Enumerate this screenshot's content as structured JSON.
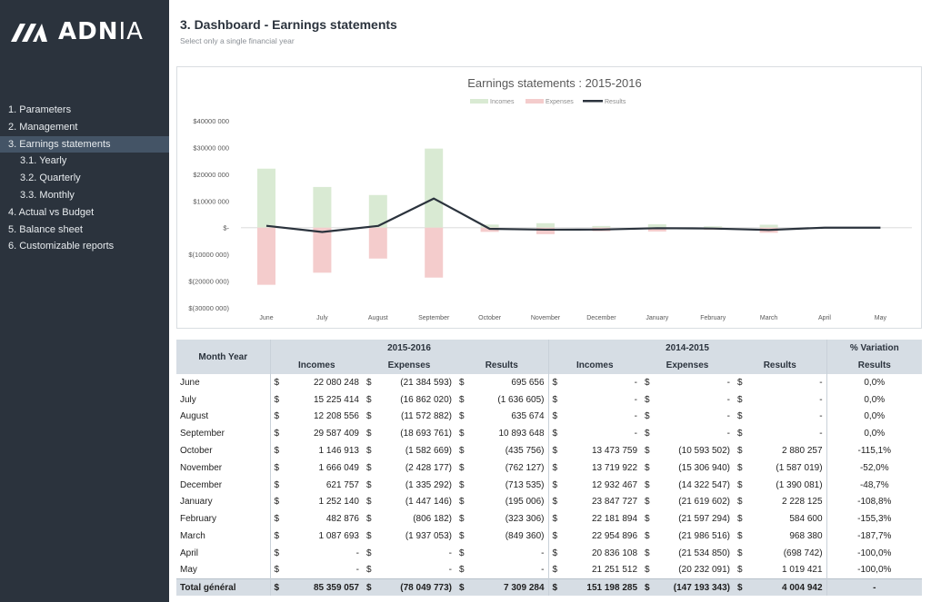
{
  "brand": {
    "name_bold": "ADN",
    "name_thin": "IA",
    "logo_icon": "adnia-logo-icon"
  },
  "sidebar": {
    "items": [
      {
        "label": "1. Parameters",
        "level": 0,
        "active": false
      },
      {
        "label": "2. Management",
        "level": 0,
        "active": false
      },
      {
        "label": "3. Earnings statements",
        "level": 0,
        "active": true
      },
      {
        "label": "3.1. Yearly",
        "level": 1,
        "active": false
      },
      {
        "label": "3.2. Quarterly",
        "level": 1,
        "active": false
      },
      {
        "label": "3.3. Monthly",
        "level": 1,
        "active": false
      },
      {
        "label": "4. Actual vs Budget",
        "level": 0,
        "active": false
      },
      {
        "label": "5. Balance sheet",
        "level": 0,
        "active": false
      },
      {
        "label": "6. Customizable reports",
        "level": 0,
        "active": false
      }
    ]
  },
  "header": {
    "title": "3. Dashboard - Earnings statements",
    "subtitle": "Select only a single financial year"
  },
  "colors": {
    "sidebar_bg": "#2b333d",
    "sidebar_active": "#445466",
    "incomes": "#d9ead3",
    "expenses": "#f4cccc",
    "results": "#2b333d",
    "table_header": "#d6dde4"
  },
  "chart_data": {
    "type": "bar",
    "title": "Earnings statements : 2015-2016",
    "legend": [
      "Incomes",
      "Expenses",
      "Results"
    ],
    "legend_position": "top",
    "categories": [
      "June",
      "July",
      "August",
      "September",
      "October",
      "November",
      "December",
      "January",
      "February",
      "March",
      "April",
      "May"
    ],
    "series": [
      {
        "name": "Incomes",
        "kind": "bar",
        "values": [
          22080248,
          15225414,
          12208556,
          29587409,
          1146913,
          1666049,
          621757,
          1252140,
          482876,
          1087693,
          0,
          0
        ]
      },
      {
        "name": "Expenses",
        "kind": "bar",
        "values": [
          -21384593,
          -16862020,
          -11572882,
          -18693761,
          -1582669,
          -2428177,
          -1335292,
          -1447146,
          -806182,
          -1937053,
          0,
          0
        ]
      },
      {
        "name": "Results",
        "kind": "line",
        "values": [
          695656,
          -1636605,
          635674,
          10893648,
          -435756,
          -762127,
          -713535,
          -195006,
          -323306,
          -849360,
          0,
          0
        ]
      }
    ],
    "ylim": [
      -30000000,
      40000000
    ],
    "yticks": [
      40000000,
      30000000,
      20000000,
      10000000,
      0,
      -10000000,
      -20000000,
      -30000000
    ],
    "ytick_labels": [
      "$40000 000",
      "$30000 000",
      "$20000 000",
      "$10000 000",
      "$-",
      "$(10000 000)",
      "$(20000 000)",
      "$(30000 000)"
    ],
    "xlabel": "",
    "ylabel": "",
    "grid": false
  },
  "table": {
    "month_header": "Month Year",
    "year1": "2015-2016",
    "year2": "2014-2015",
    "variation_header_1": "% Variation",
    "variation_header_2": "Results",
    "sub_headers": [
      "Incomes",
      "Expenses",
      "Results"
    ],
    "currency": "$",
    "rows": [
      {
        "month": "June",
        "y1": [
          "22 080 248",
          "(21 384 593)",
          "695 656"
        ],
        "y2": [
          "-",
          "-",
          "-"
        ],
        "var": "0,0%"
      },
      {
        "month": "July",
        "y1": [
          "15 225 414",
          "(16 862 020)",
          "(1 636 605)"
        ],
        "y2": [
          "-",
          "-",
          "-"
        ],
        "var": "0,0%"
      },
      {
        "month": "August",
        "y1": [
          "12 208 556",
          "(11 572 882)",
          "635 674"
        ],
        "y2": [
          "-",
          "-",
          "-"
        ],
        "var": "0,0%"
      },
      {
        "month": "September",
        "y1": [
          "29 587 409",
          "(18 693 761)",
          "10 893 648"
        ],
        "y2": [
          "-",
          "-",
          "-"
        ],
        "var": "0,0%"
      },
      {
        "month": "October",
        "y1": [
          "1 146 913",
          "(1 582 669)",
          "(435 756)"
        ],
        "y2": [
          "13 473 759",
          "(10 593 502)",
          "2 880 257"
        ],
        "var": "-115,1%"
      },
      {
        "month": "November",
        "y1": [
          "1 666 049",
          "(2 428 177)",
          "(762 127)"
        ],
        "y2": [
          "13 719 922",
          "(15 306 940)",
          "(1 587 019)"
        ],
        "var": "-52,0%"
      },
      {
        "month": "December",
        "y1": [
          "621 757",
          "(1 335 292)",
          "(713 535)"
        ],
        "y2": [
          "12 932 467",
          "(14 322 547)",
          "(1 390 081)"
        ],
        "var": "-48,7%"
      },
      {
        "month": "January",
        "y1": [
          "1 252 140",
          "(1 447 146)",
          "(195 006)"
        ],
        "y2": [
          "23 847 727",
          "(21 619 602)",
          "2 228 125"
        ],
        "var": "-108,8%"
      },
      {
        "month": "February",
        "y1": [
          "482 876",
          "(806 182)",
          "(323 306)"
        ],
        "y2": [
          "22 181 894",
          "(21 597 294)",
          "584 600"
        ],
        "var": "-155,3%"
      },
      {
        "month": "March",
        "y1": [
          "1 087 693",
          "(1 937 053)",
          "(849 360)"
        ],
        "y2": [
          "22 954 896",
          "(21 986 516)",
          "968 380"
        ],
        "var": "-187,7%"
      },
      {
        "month": "April",
        "y1": [
          "-",
          "-",
          "-"
        ],
        "y2": [
          "20 836 108",
          "(21 534 850)",
          "(698 742)"
        ],
        "var": "-100,0%"
      },
      {
        "month": "May",
        "y1": [
          "-",
          "-",
          "-"
        ],
        "y2": [
          "21 251 512",
          "(20 232 091)",
          "1 019 421"
        ],
        "var": "-100,0%"
      }
    ],
    "total": {
      "month": "Total général",
      "y1": [
        "85 359 057",
        "(78 049 773)",
        "7 309 284"
      ],
      "y2": [
        "151 198 285",
        "(147 193 343)",
        "4 004 942"
      ],
      "var": "-"
    }
  }
}
